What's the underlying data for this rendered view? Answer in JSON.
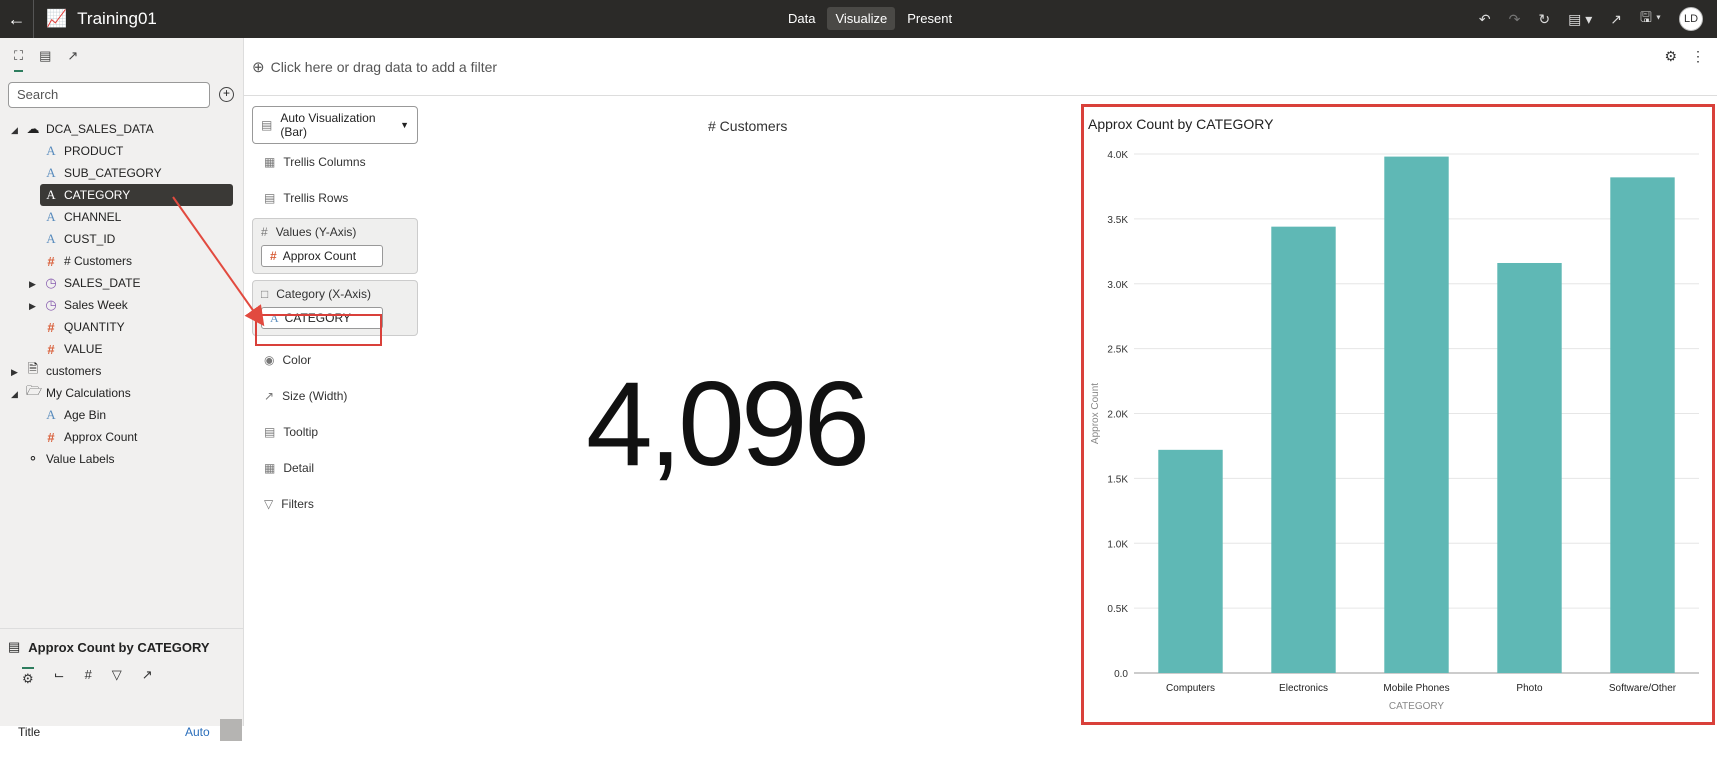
{
  "app": {
    "title": "Training01",
    "modes": [
      "Data",
      "Visualize",
      "Present"
    ],
    "active_mode": "Visualize",
    "user_initials": "LD"
  },
  "left_panel": {
    "search_placeholder": "Search",
    "tree": [
      {
        "label": "DCA_SALES_DATA",
        "type": "dataset",
        "expanded": true
      },
      {
        "label": "PRODUCT",
        "type": "attribute"
      },
      {
        "label": "SUB_CATEGORY",
        "type": "attribute"
      },
      {
        "label": "CATEGORY",
        "type": "attribute",
        "selected": true
      },
      {
        "label": "CHANNEL",
        "type": "attribute"
      },
      {
        "label": "CUST_ID",
        "type": "attribute"
      },
      {
        "label": "# Customers",
        "type": "measure"
      },
      {
        "label": "SALES_DATE",
        "type": "time"
      },
      {
        "label": "Sales Week",
        "type": "time"
      },
      {
        "label": "QUANTITY",
        "type": "measure"
      },
      {
        "label": "VALUE",
        "type": "measure"
      },
      {
        "label": "customers",
        "type": "dataset2"
      },
      {
        "label": "My Calculations",
        "type": "folder"
      },
      {
        "label": "Age Bin",
        "type": "attribute"
      },
      {
        "label": "Approx Count",
        "type": "measure"
      },
      {
        "label": "Value Labels",
        "type": "tag"
      }
    ],
    "properties": {
      "title": "Approx Count by CATEGORY",
      "title_label": "Title",
      "title_value": "Auto"
    }
  },
  "filter_bar": {
    "placeholder": "Click here or drag data to add a filter"
  },
  "grammar": {
    "visualization": "Auto Visualization (Bar)",
    "trellis_columns": "Trellis Columns",
    "trellis_rows": "Trellis Rows",
    "values_header": "Values (Y-Axis)",
    "values_item": "Approx Count",
    "category_header": "Category (X-Axis)",
    "category_item": "CATEGORY",
    "color": "Color",
    "size": "Size (Width)",
    "tooltip": "Tooltip",
    "detail": "Detail",
    "filters": "Filters"
  },
  "kpi": {
    "title": "# Customers",
    "value": "4,096"
  },
  "chart_data": {
    "type": "bar",
    "title": "Approx Count by CATEGORY",
    "xlabel": "CATEGORY",
    "ylabel": "Approx Count",
    "categories": [
      "Computers",
      "Electronics",
      "Mobile Phones",
      "Photo",
      "Software/Other"
    ],
    "values": [
      1720,
      3440,
      3980,
      3160,
      3820
    ],
    "ylim": [
      0,
      4000
    ],
    "yticks": [
      "0.0",
      "0.5K",
      "1.0K",
      "1.5K",
      "2.0K",
      "2.5K",
      "3.0K",
      "3.5K",
      "4.0K"
    ],
    "bar_color": "#5fb8b5",
    "grid": true
  }
}
